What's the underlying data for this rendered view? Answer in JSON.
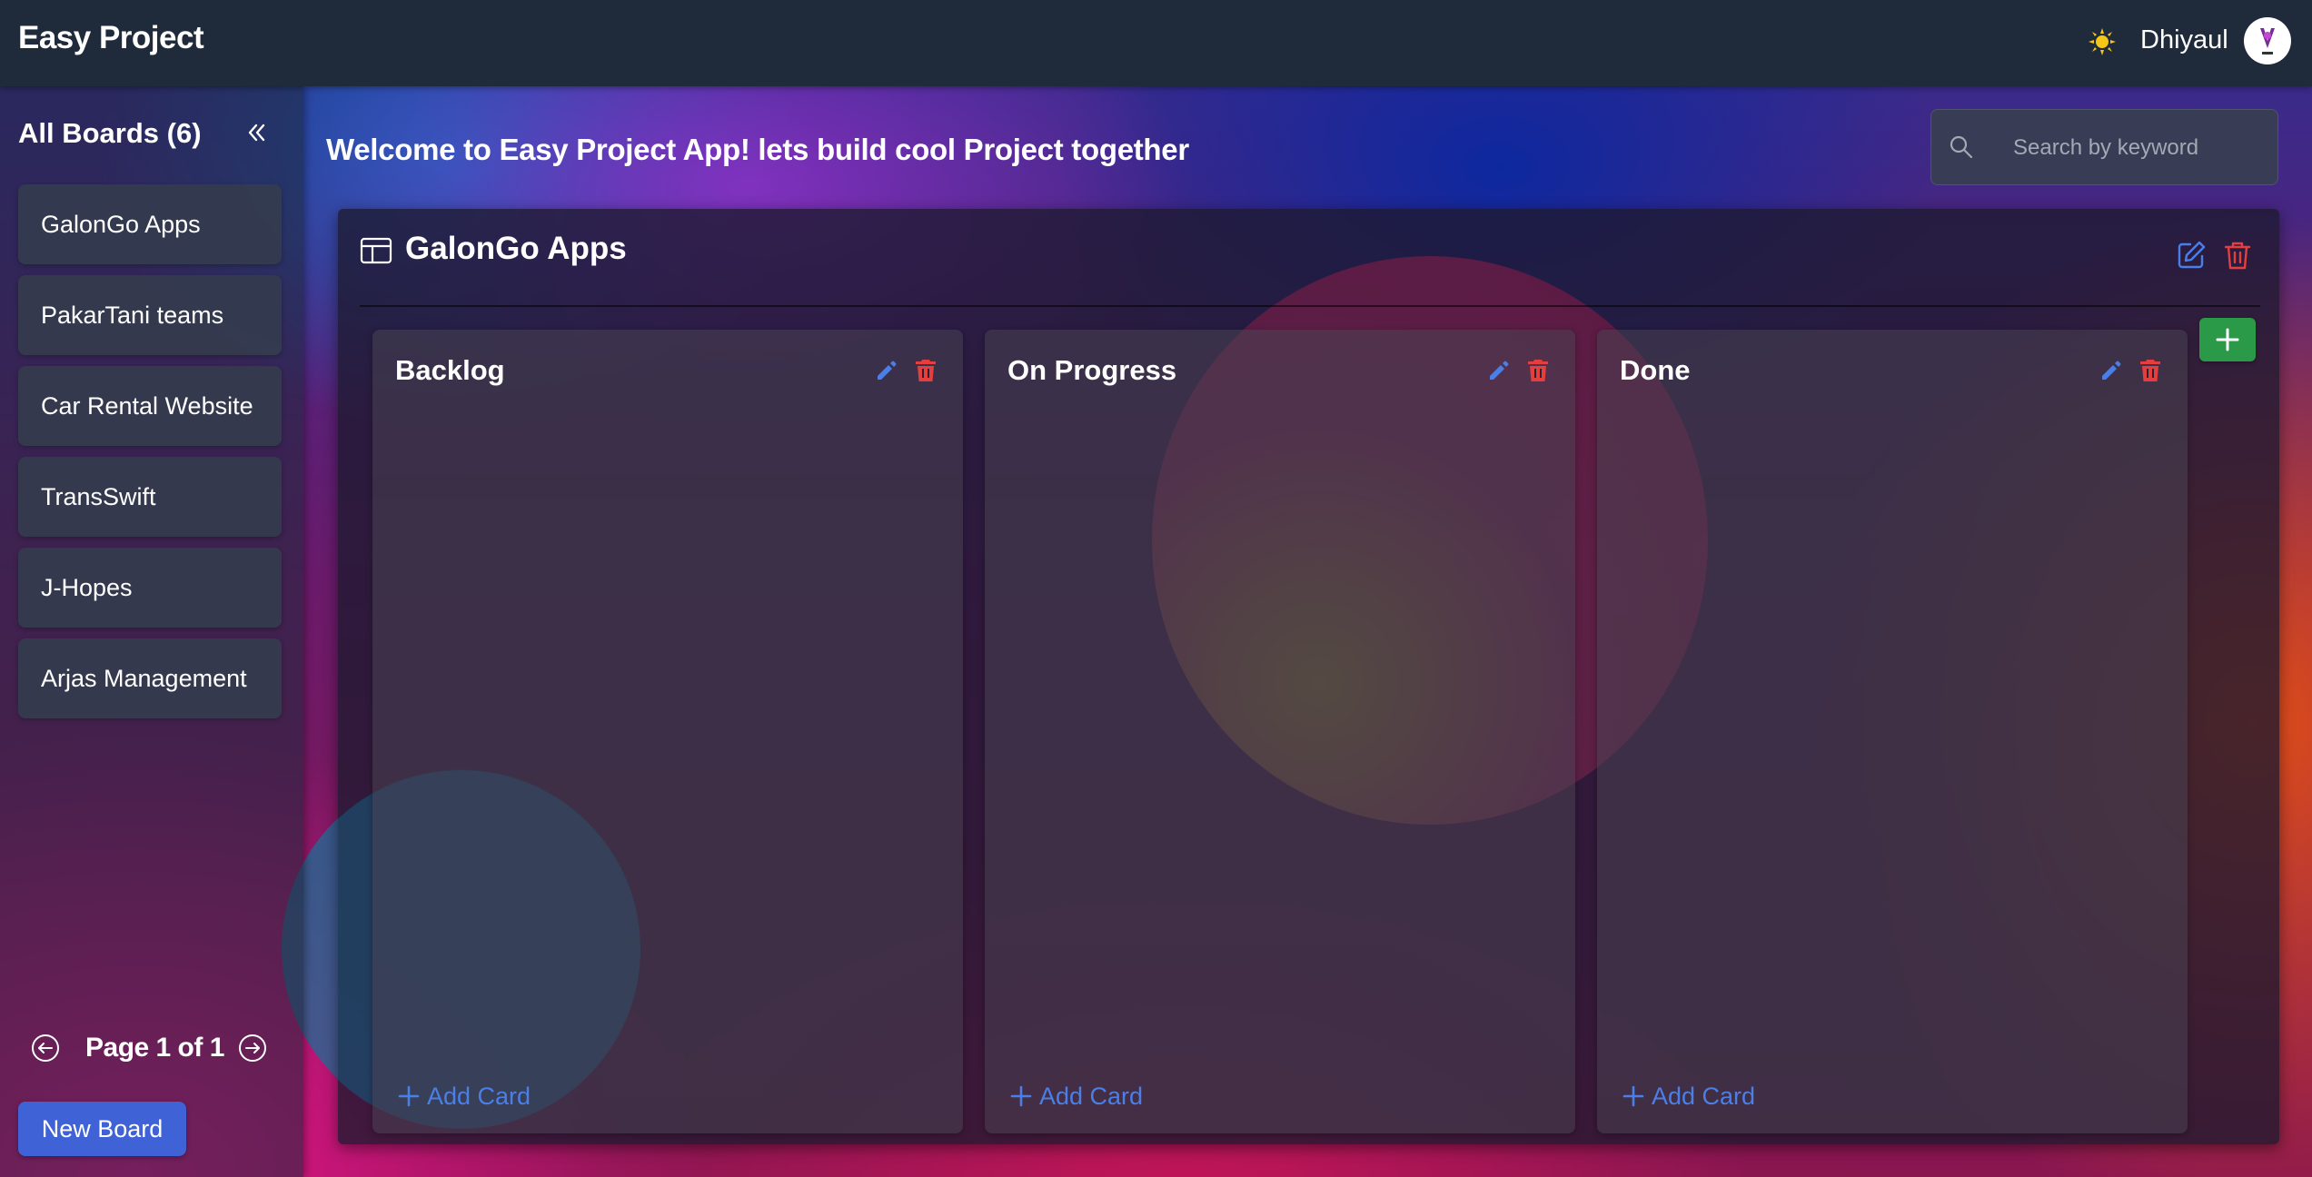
{
  "navbar": {
    "brand": "Easy Project",
    "username": "Dhiyaul",
    "theme_icon": "sun-icon",
    "avatar_icon": "avatar-logo"
  },
  "sidebar": {
    "title": "All Boards (6)",
    "collapse_icon": "double-chevron-left-icon",
    "boards": [
      {
        "label": "GalonGo Apps"
      },
      {
        "label": "PakarTani teams"
      },
      {
        "label": "Car Rental Website"
      },
      {
        "label": "TransSwift"
      },
      {
        "label": "J-Hopes"
      },
      {
        "label": "Arjas Management"
      }
    ],
    "pagination": {
      "label": "Page 1 of 1"
    },
    "new_board_label": "New Board"
  },
  "main": {
    "welcome": "Welcome to Easy Project App! lets build cool Project together",
    "search": {
      "placeholder": "Search by keyword",
      "value": ""
    },
    "board": {
      "name": "GalonGo Apps",
      "columns": [
        {
          "title": "Backlog",
          "add_card_label": "Add Card"
        },
        {
          "title": "On Progress",
          "add_card_label": "Add Card"
        },
        {
          "title": "Done",
          "add_card_label": "Add Card"
        }
      ]
    }
  },
  "colors": {
    "accent_blue": "#4a7fe8",
    "danger_red": "#e53e3e",
    "success_green": "#2a9a48",
    "new_board_button": "#3f63d6",
    "navbar_bg": "#1f2a3a"
  }
}
